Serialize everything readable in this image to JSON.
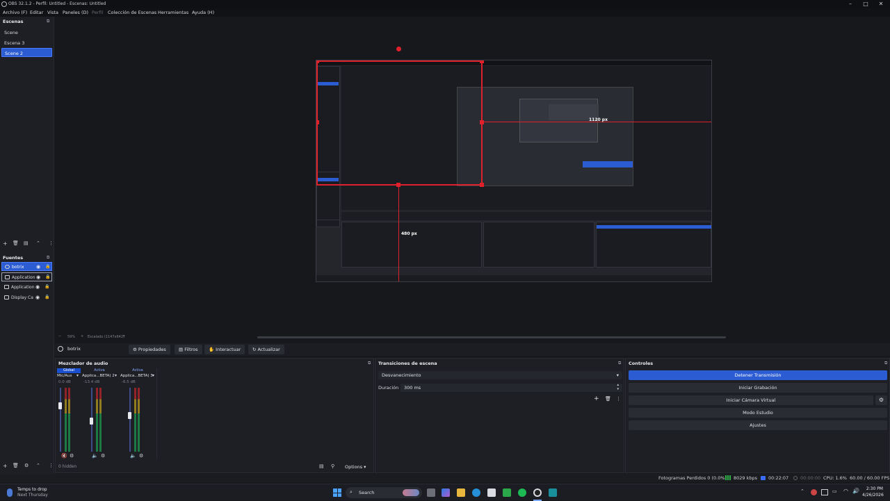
{
  "window": {
    "title": "OBS 32.1.2 - Perfil: Untitled - Escenas: Untitled"
  },
  "menu": [
    {
      "label": "Archivo (F)"
    },
    {
      "label": "Editar"
    },
    {
      "label": "Vista"
    },
    {
      "label": "Paneles (D)"
    },
    {
      "label": "Perfil",
      "disabled": true
    },
    {
      "label": "Colección de Escenas"
    },
    {
      "label": "Herramientas"
    },
    {
      "label": "Ayuda (H)"
    }
  ],
  "scenes": {
    "title": "Escenas",
    "items": [
      {
        "label": "Scene"
      },
      {
        "label": "Escena 3"
      },
      {
        "label": "Scene 2",
        "selected": true
      }
    ]
  },
  "sources": {
    "title": "Fuentes",
    "items": [
      {
        "label": "botrix",
        "selected": true
      },
      {
        "label": "Application",
        "highlighted": true
      },
      {
        "label": "Application"
      },
      {
        "label": "Display Ca"
      }
    ]
  },
  "preview": {
    "labels": {
      "width": "1120 px",
      "height": "480 px"
    },
    "zoom": "59%",
    "scale": "Escalado (1147x642)"
  },
  "propbar": {
    "source": "botrix",
    "buttons": [
      "Propiedades",
      "Filtros",
      "Interactuar",
      "Actualizar"
    ]
  },
  "mixer": {
    "title": "Mezclador de audio",
    "tabs": [
      "Global",
      "Activa",
      "Activa"
    ],
    "channels": [
      {
        "name": "Mic/Aux",
        "db": "0.0 dB",
        "level": 0.72
      },
      {
        "name": "Applica...BETA) 2",
        "db": "-13.4 dB",
        "level": 0.48
      },
      {
        "name": "Applica...BETA) 3",
        "db": "-6.5 dB",
        "level": 0.56
      }
    ],
    "scale": [
      "0",
      "-5",
      "-10",
      "-15",
      "-20",
      "-25",
      "-30",
      "-35",
      "-40",
      "-45",
      "-50",
      "-55",
      "-60"
    ],
    "hidden": "0 hidden",
    "options": "Options"
  },
  "transitions": {
    "title": "Transiciones de escena",
    "selected": "Desvanecimiento",
    "duration_label": "Duración",
    "duration_value": "300 ms"
  },
  "controls": {
    "title": "Controles",
    "buttons": [
      {
        "label": "Detener Transmisión",
        "active": true
      },
      {
        "label": "Iniciar Grabación"
      },
      {
        "label": "Iniciar Cámara Virtual"
      },
      {
        "label": "Modo Estudio"
      },
      {
        "label": "Ajustes"
      }
    ]
  },
  "status": {
    "dropped": "Fotogramas Perdidos 0 (0.0%)",
    "bitrate": "8029 kbps",
    "stream_time": "00:22:07",
    "rec_time": "00:00:00",
    "cpu": "CPU: 1.6%",
    "fps": "60.00 / 60.00 FPS"
  },
  "taskbar": {
    "weather_line1": "Temps to drop",
    "weather_line2": "Next Thursday",
    "search": "Search",
    "time": "2:30 PM",
    "date": "4/26/2026"
  }
}
